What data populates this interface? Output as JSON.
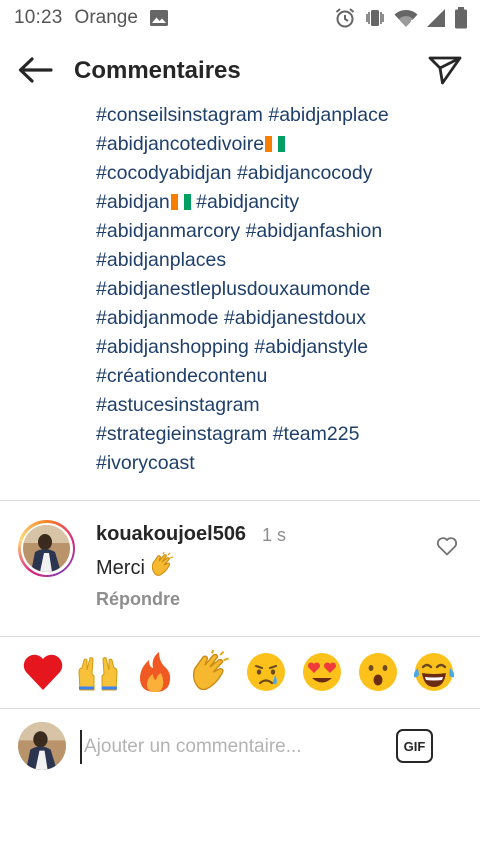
{
  "status_bar": {
    "time": "10:23",
    "carrier": "Orange",
    "icons": [
      "image-icon",
      "alarm-icon",
      "vibrate-icon",
      "wifi-icon",
      "signal-icon",
      "battery-icon"
    ]
  },
  "header": {
    "title": "Commentaires",
    "back_icon": "arrow-left-icon",
    "share_icon": "paper-plane-icon"
  },
  "caption": {
    "lines": [
      [
        "#conseilsinstagram",
        "#abidjanplace"
      ],
      [
        "#abidjancotedivoire"
      ],
      [
        "#cocodyabidjan",
        "#abidjancocody"
      ],
      [
        "#abidjan",
        "#abidjancity"
      ],
      [
        "#abidjanmarcory",
        "#abidjanfashion"
      ],
      [
        "#abidjanplaces"
      ],
      [
        "#abidjanestleplusdouxaumonde"
      ],
      [
        "#abidjanmode",
        "#abidjanestdoux"
      ],
      [
        "#abidjanshopping",
        "#abidjanstyle"
      ],
      [
        "#créationdecontenu"
      ],
      [
        "#astucesinstagram"
      ],
      [
        "#strategieinstagram",
        "#team225"
      ],
      [
        "#ivorycoast"
      ]
    ],
    "flag_after": [
      "#abidjancotedivoire",
      "#abidjan"
    ],
    "hashtag_color": "#1f3f6b"
  },
  "comment": {
    "username": "kouakoujoel506",
    "time": "1 s",
    "text": "Merci",
    "text_emoji": "clapping-hands",
    "reply_label": "Répondre",
    "like_icon": "heart-outline-icon"
  },
  "quick_reactions": [
    {
      "name": "red-heart",
      "glyph": "❤️"
    },
    {
      "name": "raising-hands",
      "glyph": "🙌"
    },
    {
      "name": "fire",
      "glyph": "🔥"
    },
    {
      "name": "clapping-hands",
      "glyph": "👏"
    },
    {
      "name": "crying-face",
      "glyph": "😢"
    },
    {
      "name": "heart-eyes",
      "glyph": "😍"
    },
    {
      "name": "astonished-face",
      "glyph": "😮"
    },
    {
      "name": "tears-of-joy",
      "glyph": "😂"
    }
  ],
  "composer": {
    "placeholder": "Ajouter un commentaire...",
    "value": "",
    "gif_label": "GIF"
  },
  "colors": {
    "story_ring": [
      "#f58529",
      "#dd2a7b",
      "#8134af"
    ],
    "secondary_text": "#8e8e8e",
    "divider": "#dbdbdb"
  }
}
